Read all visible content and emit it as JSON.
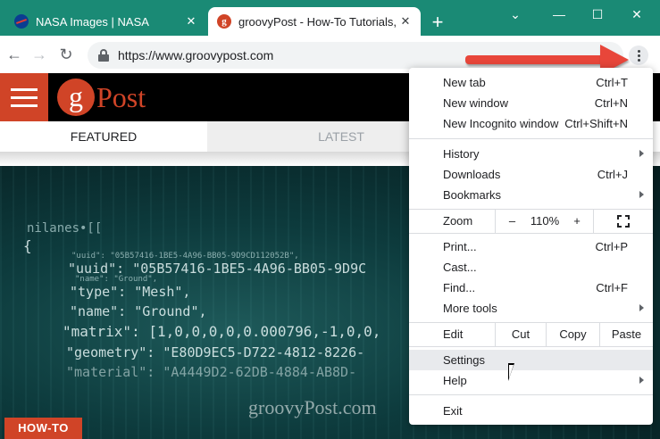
{
  "browser": {
    "tabs": [
      {
        "title": "NASA Images | NASA",
        "favicon": "nasa-logo-icon",
        "active": false
      },
      {
        "title": "groovyPost - How-To Tutorials, R",
        "favicon": "groovypost-g-icon",
        "active": true
      }
    ],
    "new_tab_symbol": "+",
    "url": "https://www.groovypost.com",
    "theme_color": "#1a8a75"
  },
  "site": {
    "logo_letter": "g",
    "logo_text": "Post",
    "brand_color": "#d04427",
    "tabs": [
      "FEATURED",
      "LATEST"
    ],
    "badge": "HOW-TO",
    "watermark": "groovyPost.com",
    "code_lines": [
      "nilanes•[[",
      "{",
      "\"uuid\": \"05B57416-1BE5-4A96-BB05-9D9CD112052B\",",
      "\"uuid\": \"05B57416-1BE5-4A96-BB05-9D9C",
      "\"name\": \"Ground\",",
      "\"type\": \"Mesh\",",
      "\"name\": \"Ground\",",
      "\"matrix\": [1,0,0,0,0,0.000796,-1,0,0,",
      "\"geometry\": \"E80D9EC5-D722-4812-8226-",
      "\"material\": \"A4449D2-62DB-4884-AB8D-"
    ]
  },
  "menu": {
    "group1": [
      {
        "label": "New tab",
        "shortcut": "Ctrl+T"
      },
      {
        "label": "New window",
        "shortcut": "Ctrl+N"
      },
      {
        "label": "New Incognito window",
        "shortcut": "Ctrl+Shift+N"
      }
    ],
    "group2": [
      {
        "label": "History",
        "shortcut": ""
      },
      {
        "label": "Downloads",
        "shortcut": "Ctrl+J"
      },
      {
        "label": "Bookmarks",
        "shortcut": ""
      }
    ],
    "zoom": {
      "label": "Zoom",
      "minus": "–",
      "value": "110%",
      "plus": "+"
    },
    "group3": [
      {
        "label": "Print...",
        "shortcut": "Ctrl+P"
      },
      {
        "label": "Cast...",
        "shortcut": ""
      },
      {
        "label": "Find...",
        "shortcut": "Ctrl+F"
      },
      {
        "label": "More tools",
        "shortcut": ""
      }
    ],
    "edit": {
      "label": "Edit",
      "cut": "Cut",
      "copy": "Copy",
      "paste": "Paste"
    },
    "group4": [
      {
        "label": "Settings",
        "shortcut": ""
      },
      {
        "label": "Help",
        "shortcut": ""
      }
    ],
    "exit": {
      "label": "Exit"
    }
  },
  "annotation": {
    "arrow_color": "#e8463a"
  }
}
